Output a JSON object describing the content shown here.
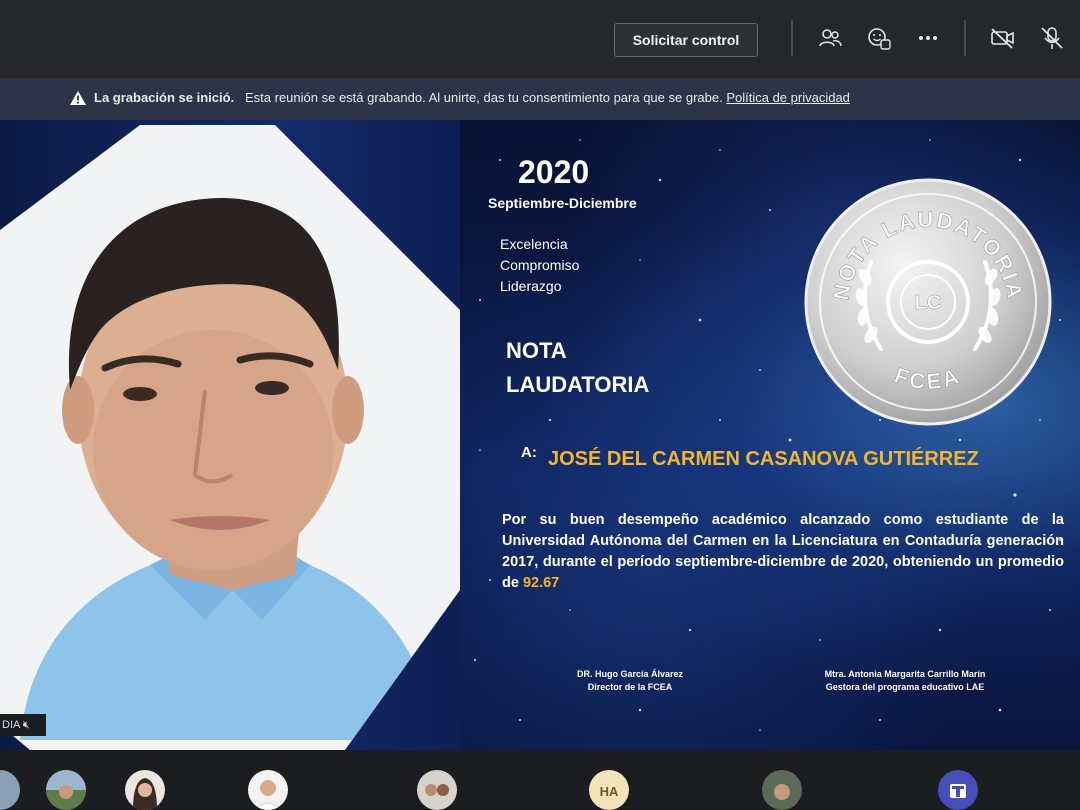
{
  "toolbar": {
    "request_control_label": "Solicitar control",
    "icons": [
      "participants-icon",
      "reactions-icon",
      "more-options-icon",
      "camera-off-icon",
      "mic-off-icon"
    ]
  },
  "banner": {
    "title": "La grabación se inició.",
    "message": "Esta reunión se está grabando. Al unirte, das tu consentimiento para que se grabe.",
    "link": "Política de privacidad"
  },
  "video": {
    "name_tag": "DIA"
  },
  "slide": {
    "year": "2020",
    "period": "Septiembre-Diciembre",
    "values": [
      "Excelencia",
      "Compromiso",
      "Liderazgo"
    ],
    "nota_line1": "NOTA",
    "nota_line2": "LAUDATORIA",
    "medal": {
      "top_text": "NOTA LAUDATORIA",
      "center": "LC",
      "bottom_text": "FCEA"
    },
    "a_label": "A:",
    "recipient": "JOSÉ DEL CARMEN CASANOVA GUTIÉRREZ",
    "body_text": "Por su buen desempeño académico alcanzado como estudiante de la Universidad Autónoma del Carmen en la Licenciatura en Contaduría generación 2017, durante el período septiembre-diciembre de 2020, obteniendo un promedio de",
    "average": "92.67",
    "signature_left": {
      "name": "DR. Hugo García Álvarez",
      "role": "Director de la FCEA"
    },
    "signature_right": {
      "name": "Mtra. Antonia Margarita Carrillo Marín",
      "role": "Gestora del programa educativo LAE"
    }
  },
  "participants": {
    "initials": "HA"
  },
  "colors": {
    "accent_gold": "#f5b52b",
    "banner_bg": "#2d3448",
    "toolbar_bg": "#26272b"
  }
}
